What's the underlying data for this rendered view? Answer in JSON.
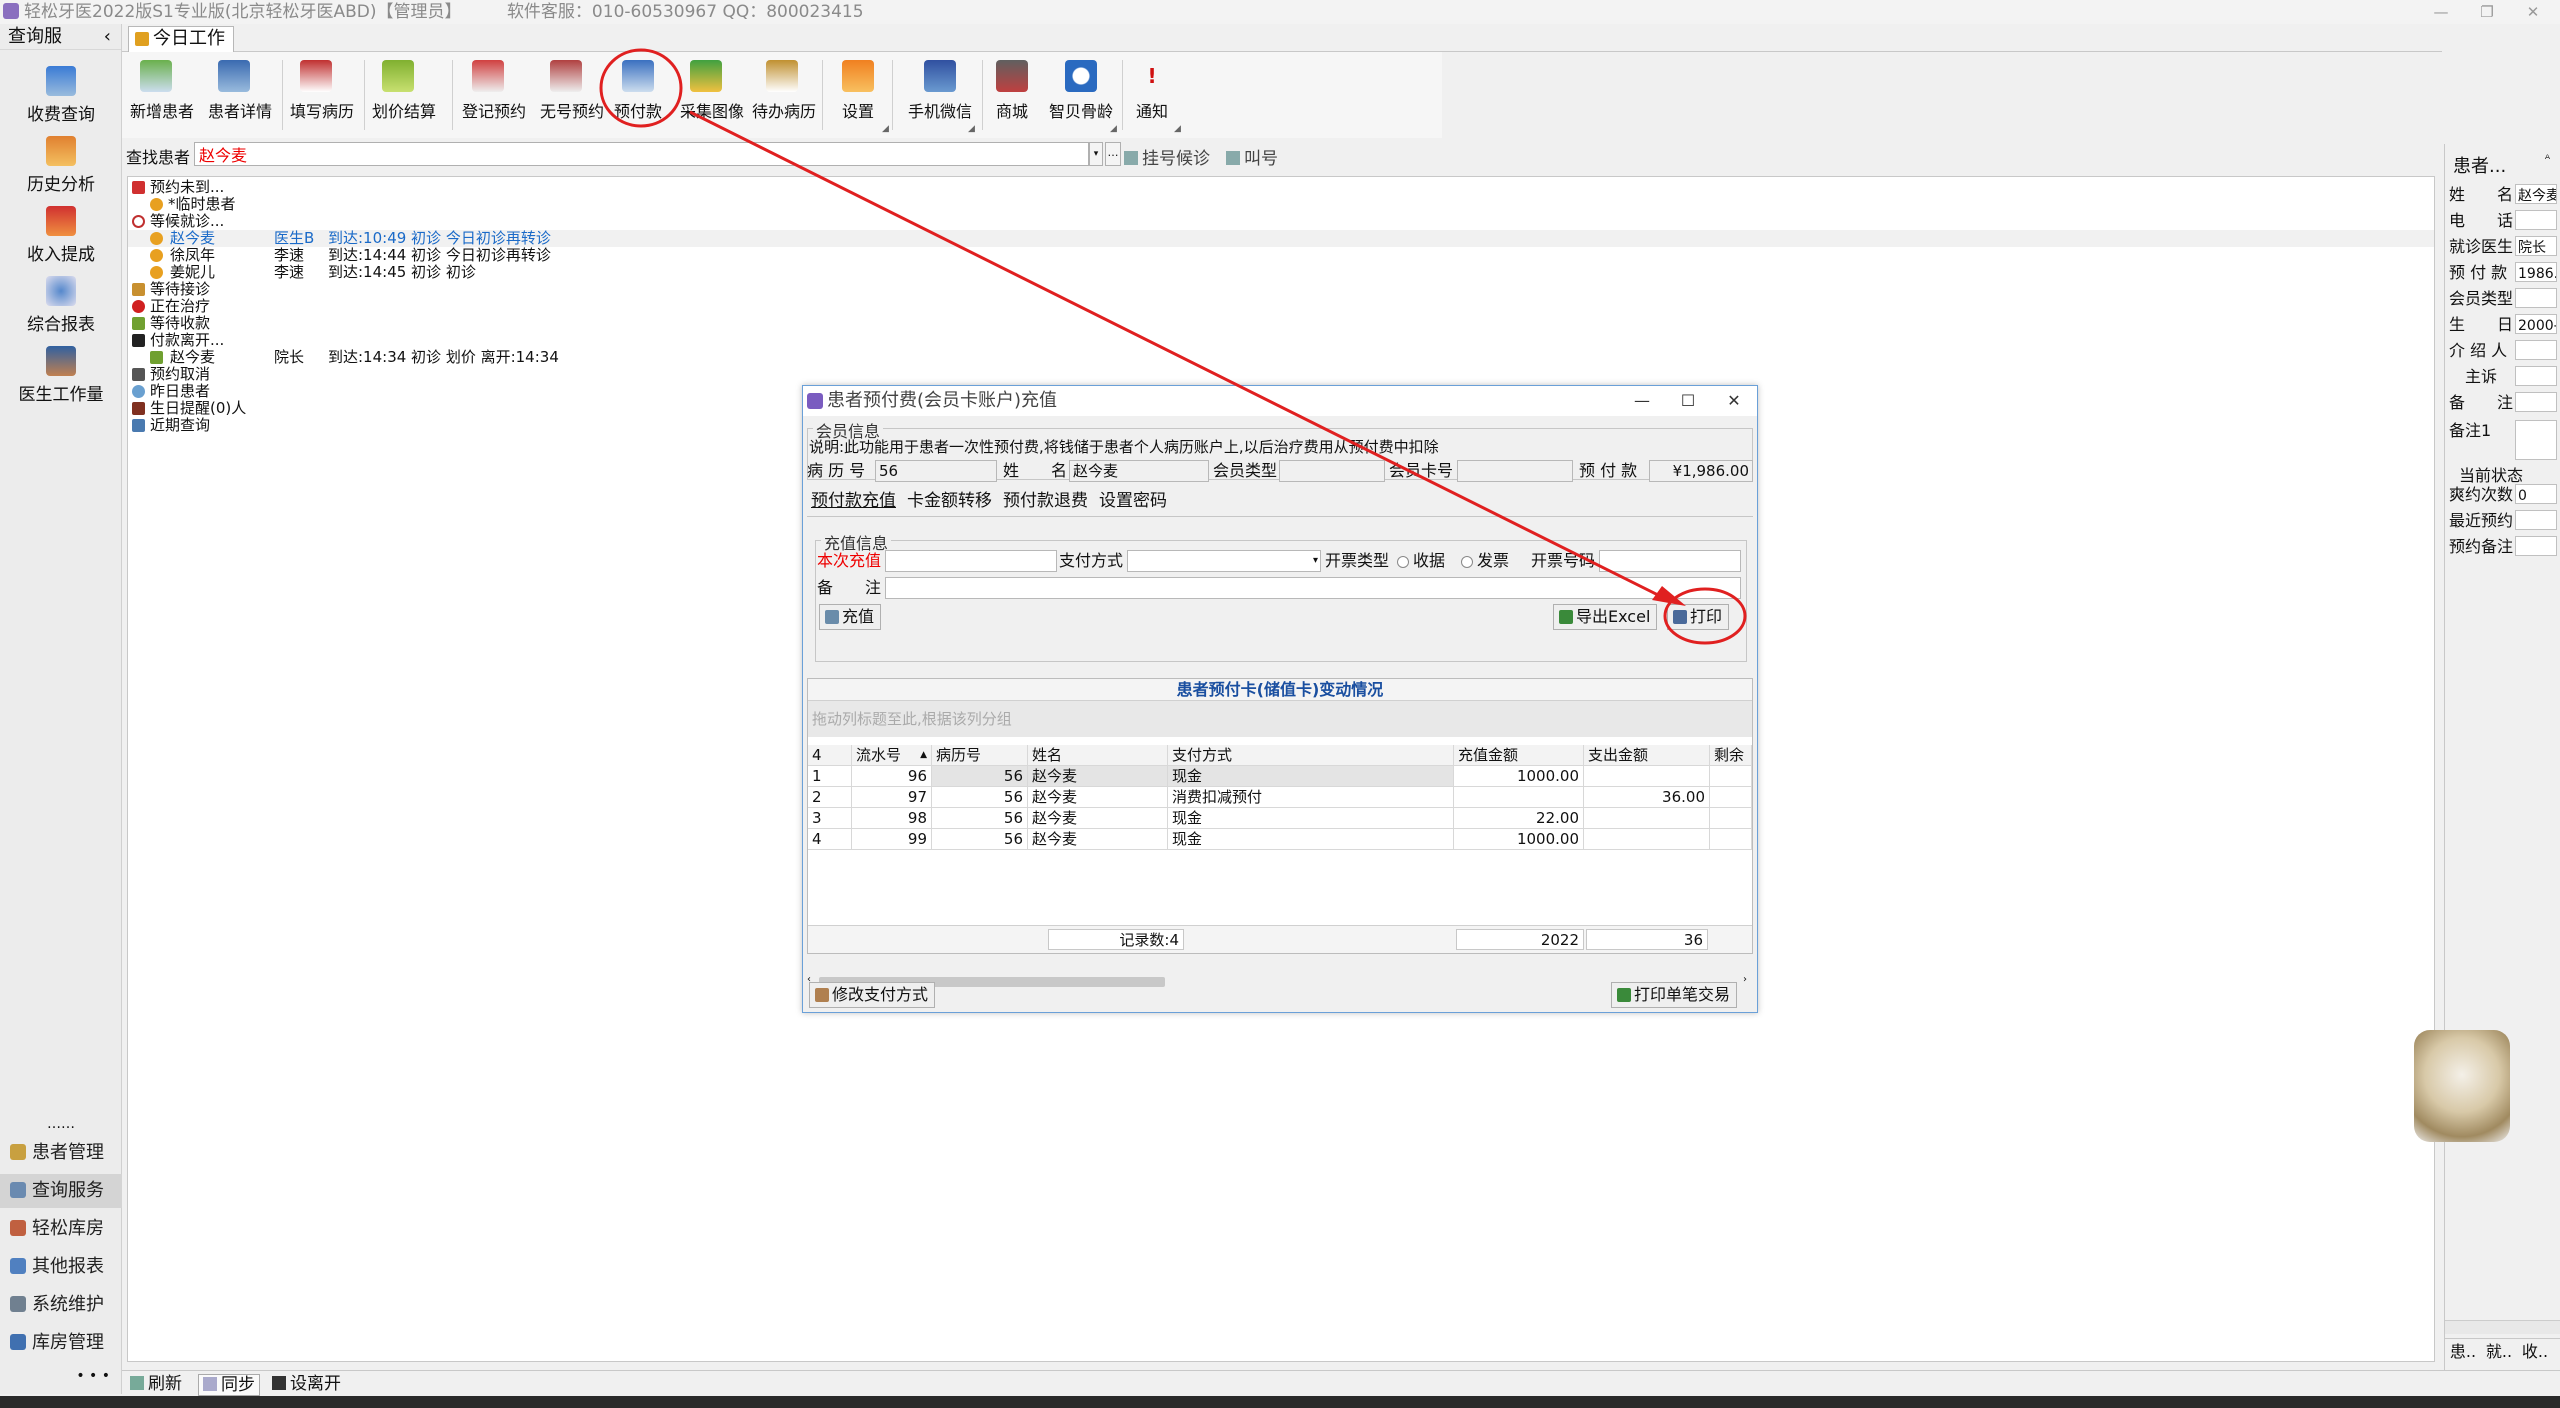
{
  "window": {
    "title": "轻松牙医2022版S1专业版(北京轻松牙医ABD)【管理员】",
    "support": "软件客服：010-60530967 QQ：800023415"
  },
  "leftnav": {
    "header": "查询服",
    "items": [
      "收费查询",
      "历史分析",
      "收入提成",
      "综合报表",
      "医生工作量"
    ],
    "dots": "……",
    "bottom": [
      "患者管理",
      "查询服务",
      "轻松库房",
      "其他报表",
      "系统维护",
      "库房管理"
    ],
    "more": "• • •"
  },
  "tab": {
    "label": "今日工作"
  },
  "toolbar": {
    "buttons": [
      "新增患者",
      "患者详情",
      "填写病历",
      "划价结算",
      "登记预约",
      "无号预约",
      "预付款",
      "采集图像",
      "待办病历",
      "设置",
      "手机微信",
      "商城",
      "智贝骨龄",
      "通知"
    ]
  },
  "search": {
    "label": "查找患者",
    "value": "赵今麦",
    "register_label": "挂号候诊",
    "call_label": "叫号"
  },
  "queue": {
    "groups": {
      "unarrived": "预约未到...",
      "temp_patient": "*临时患者",
      "waiting": "等候就诊...",
      "wait_accept": "等待接诊",
      "treating": "正在治疗",
      "wait_pay": "等待收款",
      "paid_left": "付款离开...",
      "cancel": "预约取消",
      "yesterday": "昨日患者",
      "birthday": "生日提醒(0)人",
      "recent": "近期查询"
    },
    "waiting_rows": [
      {
        "name": "赵今麦",
        "doctor": "医生B",
        "info": "到达:10:49 初诊 今日初诊再转诊"
      },
      {
        "name": "徐凤年",
        "doctor": "李速",
        "info": "到达:14:44 初诊 今日初诊再转诊"
      },
      {
        "name": "姜妮儿",
        "doctor": "李速",
        "info": "到达:14:45 初诊 初诊"
      }
    ],
    "left_rows": [
      {
        "name": "赵今麦",
        "doctor": "院长",
        "info": "到达:14:34 初诊 划价 离开:14:34"
      }
    ]
  },
  "rightpanel": {
    "title": "患者...",
    "pin": "ᴬ",
    "fields": [
      {
        "label": "姓　　名",
        "value": "赵今麦"
      },
      {
        "label": "电　　话",
        "value": ""
      },
      {
        "label": "就诊医生",
        "value": "院长"
      },
      {
        "label": "预 付 款",
        "value": "1986."
      },
      {
        "label": "会员类型",
        "value": ""
      },
      {
        "label": "生　　日",
        "value": "2000-"
      },
      {
        "label": "介 绍 人",
        "value": ""
      },
      {
        "label": "　主诉",
        "value": ""
      },
      {
        "label": "备　　注",
        "value": ""
      },
      {
        "label": "备注1",
        "value": ""
      }
    ],
    "status_title": "当前状态",
    "status": [
      {
        "label": "爽约次数",
        "value": "0"
      },
      {
        "label": "最近预约",
        "value": ""
      },
      {
        "label": "预约备注",
        "value": ""
      }
    ],
    "tabs": [
      "患..",
      "就..",
      "收.."
    ]
  },
  "statusbar": {
    "refresh": "刷新",
    "sync": "同步",
    "leave": "设离开"
  },
  "dialog": {
    "title": "患者预付费(会员卡账户)充值",
    "member_legend": "会员信息",
    "desc": "说明:此功能用于患者一次性预付费,将钱储于患者个人病历账户上,以后治疗费用从预付费中扣除",
    "record_label": "病 历 号",
    "record_value": "56",
    "surname_label": "姓",
    "name_label": "名",
    "name_value": "赵今麦",
    "member_type_label": "会员类型",
    "card_label": "会员卡号",
    "prepay_label": "预 付 款",
    "prepay_value": "¥1,986.00",
    "tabs": [
      "预付款充值",
      "卡金额转移",
      "预付款退费",
      "设置密码"
    ],
    "charge_legend": "充值信息",
    "charge_label": "本次充值",
    "pay_method_label": "支付方式",
    "invoice_type_label": "开票类型",
    "receipt_label": "收据",
    "invoice_label": "发票",
    "invoice_no_label": "开票号码",
    "remark_label": "备　　注",
    "btn_charge": "充值",
    "btn_export": "导出Excel",
    "btn_print": "打印",
    "grid_title": "患者预付卡(储值卡)变动情况",
    "grid_group_hint": "拖动列标题至此,根据该列分组",
    "columns": [
      "4",
      "流水号",
      "病历号",
      "姓名",
      "支付方式",
      "充值金额",
      "支出金额",
      "剩余"
    ],
    "rows": [
      {
        "idx": "1",
        "serial": "96",
        "record": "56",
        "name": "赵今麦",
        "method": "现金",
        "charge": "1000.00",
        "spend": ""
      },
      {
        "idx": "2",
        "serial": "97",
        "record": "56",
        "name": "赵今麦",
        "method": "消费扣减预付",
        "charge": "",
        "spend": "36.00"
      },
      {
        "idx": "3",
        "serial": "98",
        "record": "56",
        "name": "赵今麦",
        "method": "现金",
        "charge": "22.00",
        "spend": ""
      },
      {
        "idx": "4",
        "serial": "99",
        "record": "56",
        "name": "赵今麦",
        "method": "现金",
        "charge": "1000.00",
        "spend": ""
      }
    ],
    "footer_count": "记录数:4",
    "footer_charge": "2022",
    "footer_spend": "36",
    "btn_modify": "修改支付方式",
    "btn_print_single": "打印单笔交易"
  },
  "annotation": {
    "color": "#e02020"
  }
}
